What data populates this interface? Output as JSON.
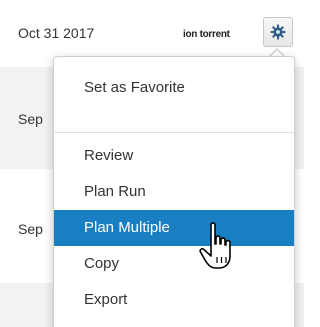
{
  "rows": [
    {
      "date": "Oct 31 2017",
      "brand": "ion torrent"
    },
    {
      "date": "Sep"
    },
    {
      "date": "Sep"
    }
  ],
  "menu": {
    "items": [
      {
        "label": "Set as Favorite"
      },
      {
        "label": "Review"
      },
      {
        "label": "Plan Run"
      },
      {
        "label": "Plan Multiple",
        "state": "hover"
      },
      {
        "label": "Copy"
      },
      {
        "label": "Export"
      }
    ]
  },
  "icons": {
    "gear": "gear-icon",
    "cursor": "hand-pointer-icon"
  },
  "colors": {
    "highlight": "#1a7fc2",
    "highlight_text": "#ffffff",
    "row_band": "#f2f2f2",
    "text": "#333333"
  }
}
